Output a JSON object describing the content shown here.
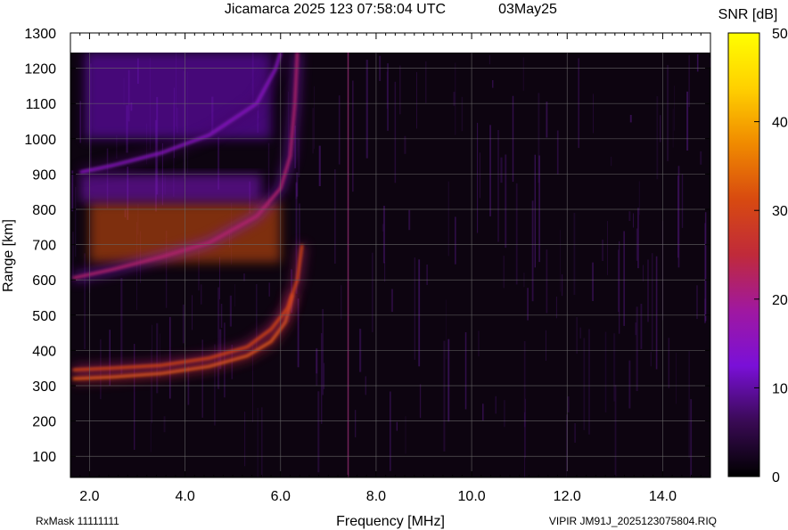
{
  "header": {
    "title": "Jicamarca 2025 123 07:58:04 UTC",
    "date": "03May25"
  },
  "footer": {
    "rx_mask": "RxMask 11111111",
    "file_id": "VIPIR  JM91J_2025123075804.RIQ"
  },
  "chart_data": {
    "type": "heatmap",
    "title": "Jicamarca 2025 123 07:58:04 UTC",
    "xlabel": "Frequency [MHz]",
    "ylabel": "Range [km]",
    "xlim": [
      1.6,
      15.0
    ],
    "ylim": [
      40,
      1300
    ],
    "data_top_range_km": 1245,
    "xticks": [
      2.0,
      4.0,
      6.0,
      8.0,
      10.0,
      12.0,
      14.0
    ],
    "xtick_labels": [
      "2.0",
      "4.0",
      "6.0",
      "8.0",
      "10.0",
      "12.0",
      "14.0"
    ],
    "yticks": [
      100,
      200,
      300,
      400,
      500,
      600,
      700,
      800,
      900,
      1000,
      1100,
      1200,
      1300
    ],
    "ytick_labels": [
      "100",
      "200",
      "300",
      "400",
      "500",
      "600",
      "700",
      "800",
      "900",
      "1000",
      "1100",
      "1200",
      "1300"
    ],
    "grid": true,
    "colorbar": {
      "label": "SNR [dB]",
      "min": 0,
      "max": 50,
      "ticks": [
        0,
        10,
        20,
        30,
        40,
        50
      ],
      "tick_labels": [
        "0",
        "10",
        "20",
        "30",
        "40",
        "50"
      ],
      "colors": [
        "#000000",
        "#3a0a55",
        "#7a10d8",
        "#a018a0",
        "#c02a3a",
        "#d84a10",
        "#f08a00",
        "#ffd000",
        "#ffff00"
      ]
    },
    "traces": [
      {
        "name": "",
        "snr_db": 33,
        "points": [
          [
            1.65,
            320
          ],
          [
            2.5,
            325
          ],
          [
            3.5,
            335
          ],
          [
            4.5,
            355
          ],
          [
            5.3,
            385
          ],
          [
            5.8,
            425
          ],
          [
            6.1,
            480
          ],
          [
            6.2,
            530
          ],
          [
            6.25,
            560
          ]
        ]
      },
      {
        "name": "",
        "snr_db": 30,
        "points": [
          [
            1.65,
            345
          ],
          [
            2.5,
            350
          ],
          [
            3.5,
            358
          ],
          [
            4.5,
            378
          ],
          [
            5.3,
            410
          ],
          [
            5.8,
            460
          ],
          [
            6.15,
            520
          ],
          [
            6.35,
            600
          ],
          [
            6.45,
            700
          ]
        ]
      },
      {
        "name": "",
        "snr_db": 22,
        "points": [
          [
            1.65,
            605
          ],
          [
            2.5,
            630
          ],
          [
            3.5,
            665
          ],
          [
            4.5,
            705
          ],
          [
            5.5,
            780
          ],
          [
            6.0,
            860
          ],
          [
            6.2,
            950
          ],
          [
            6.3,
            1100
          ],
          [
            6.35,
            1245
          ]
        ]
      },
      {
        "name": "",
        "snr_db": 15,
        "points": [
          [
            1.8,
            905
          ],
          [
            2.5,
            925
          ],
          [
            3.5,
            960
          ],
          [
            4.5,
            1010
          ],
          [
            5.5,
            1100
          ],
          [
            5.9,
            1200
          ],
          [
            6.0,
            1245
          ]
        ]
      }
    ],
    "regions": [
      {
        "snr_db": 32,
        "f": [
          2.0,
          6.0
        ],
        "range_km": [
          650,
          820
        ]
      },
      {
        "snr_db": 14,
        "f": [
          1.8,
          5.6
        ],
        "range_km": [
          820,
          900
        ]
      },
      {
        "snr_db": 12,
        "f": [
          1.9,
          5.8
        ],
        "range_km": [
          1000,
          1245
        ]
      }
    ]
  }
}
